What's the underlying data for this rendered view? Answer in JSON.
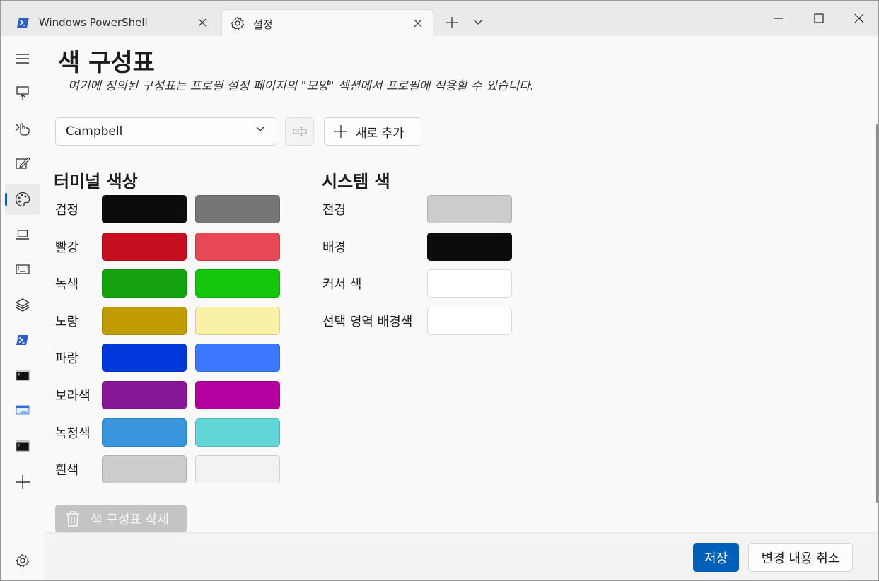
{
  "tabs": [
    {
      "label": "Windows PowerShell",
      "icon": "powershell-icon"
    },
    {
      "label": "설정",
      "icon": "gear-icon"
    }
  ],
  "page": {
    "title": "색 구성표",
    "description": "여기에 정의된 구성표는 프로필 설정 페이지의 \"모양\" 섹션에서 프로필에 적용할 수 있습니다."
  },
  "scheme_select": {
    "value": "Campbell"
  },
  "add_new_label": "새로 추가",
  "terminal_colors": {
    "title": "터미널 색상",
    "rows": [
      {
        "label": "검정",
        "normal": "#0c0c0c",
        "bright": "#767676"
      },
      {
        "label": "빨강",
        "normal": "#c50f1f",
        "bright": "#e74856"
      },
      {
        "label": "녹색",
        "normal": "#13a10e",
        "bright": "#16c60c"
      },
      {
        "label": "노랑",
        "normal": "#c19c00",
        "bright": "#f9f1a5"
      },
      {
        "label": "파랑",
        "normal": "#0037da",
        "bright": "#3b78ff"
      },
      {
        "label": "보라색",
        "normal": "#881798",
        "bright": "#b4009e"
      },
      {
        "label": "녹청색",
        "normal": "#3a96dd",
        "bright": "#61d6d6"
      },
      {
        "label": "흰색",
        "normal": "#cccccc",
        "bright": "#f2f2f2"
      }
    ]
  },
  "system_colors": {
    "title": "시스템 색",
    "rows": [
      {
        "label": "전경",
        "color": "#cccccc"
      },
      {
        "label": "배경",
        "color": "#0c0c0c"
      },
      {
        "label": "커서 색",
        "color": "#ffffff"
      },
      {
        "label": "선택 영역 배경색",
        "color": "#ffffff"
      }
    ]
  },
  "delete_label": "색 구성표 삭제",
  "footer": {
    "save_label": "저장",
    "discard_label": "변경 내용 취소"
  },
  "accent_color": "#005fb8"
}
